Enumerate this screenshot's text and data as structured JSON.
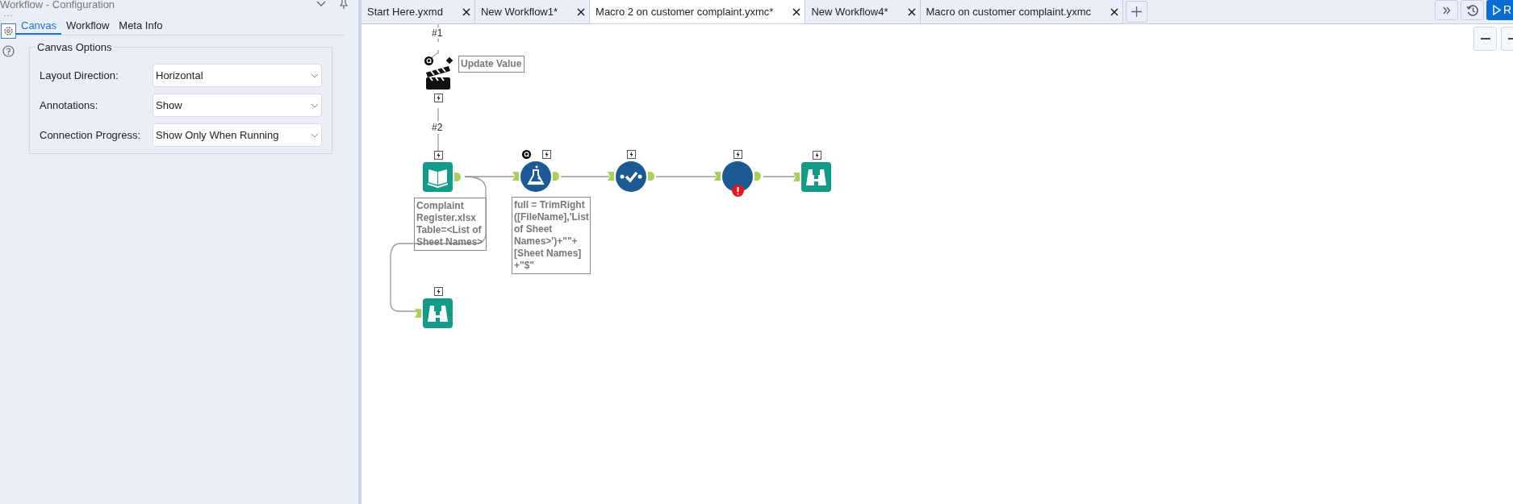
{
  "config_panel": {
    "title": "Workflow - Configuration",
    "tabs": [
      {
        "label": "Canvas",
        "selected": true
      },
      {
        "label": "Workflow",
        "selected": false
      },
      {
        "label": "Meta Info",
        "selected": false
      }
    ],
    "group": {
      "title": "Canvas Options",
      "fields": [
        {
          "label": "Layout Direction:",
          "value": "Horizontal"
        },
        {
          "label": "Annotations:",
          "value": "Show"
        },
        {
          "label": "Connection Progress:",
          "value": "Show Only When Running"
        }
      ]
    }
  },
  "document_tabs": [
    {
      "label": "Start Here.yxmd",
      "selected": false
    },
    {
      "label": "New Workflow1*",
      "selected": false
    },
    {
      "label": "Macro 2 on customer complaint.yxmc*",
      "selected": true
    },
    {
      "label": "New Workflow4*",
      "selected": false
    },
    {
      "label": "Macro on customer complaint.yxmc",
      "selected": false
    }
  ],
  "run_button": {
    "label": "R"
  },
  "canvas": {
    "connection_labels": [
      "#1",
      "#2"
    ],
    "nodes": [
      {
        "kind": "action",
        "interface_badge": true,
        "error": false,
        "annotation": "Update Value"
      },
      {
        "kind": "input",
        "interface_badge": false,
        "error": false,
        "annotation": "Complaint Register.xlsx Table=<List of Sheet Names>"
      },
      {
        "kind": "formula",
        "interface_badge": true,
        "error": false,
        "annotation": "full = TrimRight ([FileName],'List of Sheet Names>')+\"\"+ [Sheet Names] +\"$\""
      },
      {
        "kind": "select",
        "interface_badge": false,
        "error": false
      },
      {
        "kind": "blank",
        "interface_badge": false,
        "error": true
      },
      {
        "kind": "browse",
        "interface_badge": false,
        "error": false
      },
      {
        "kind": "browse",
        "interface_badge": false,
        "error": false
      }
    ]
  }
}
